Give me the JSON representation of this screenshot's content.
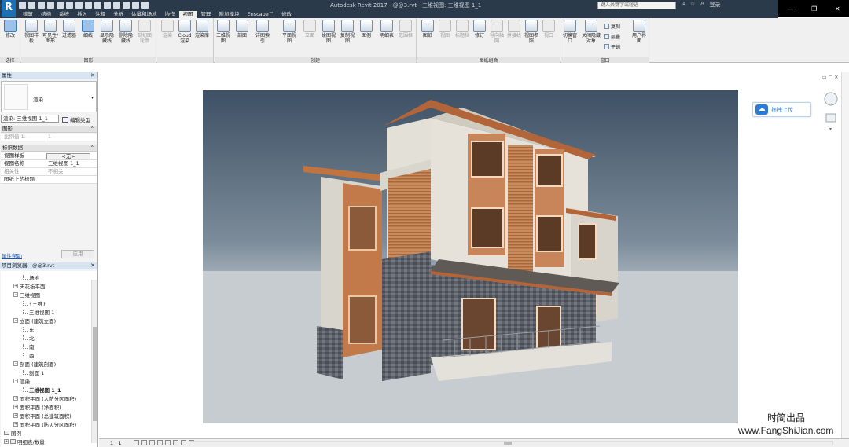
{
  "app": {
    "title": "Autodesk Revit 2017  -  @@3.rvt - 三维视图: 三维视图 1_1",
    "logo_letter": "R",
    "search_placeholder": "键入关键字或短语",
    "login": "登录",
    "window_controls": [
      "—",
      "❐",
      "✕"
    ]
  },
  "tabs": [
    "建筑",
    "结构",
    "系统",
    "插入",
    "注释",
    "分析",
    "体量和场地",
    "协作",
    "视图",
    "管理",
    "附加模块",
    "Enscape™",
    "修改"
  ],
  "active_tab": "视图",
  "ribbon": {
    "select": {
      "label": "选择",
      "modify": "修改"
    },
    "graphics": {
      "label": "图形",
      "buttons": [
        "视图样板",
        "可见性/图形",
        "过滤器",
        "细线",
        "显示隐藏线",
        "删除隐藏线",
        "剖切面轮廓"
      ]
    },
    "presentation": {
      "buttons": [
        "渲染",
        "Cloud渲染",
        "渲染库"
      ]
    },
    "create": {
      "label": "创建",
      "buttons": [
        "三维视图",
        "剖面",
        "详图索引",
        "平面视图",
        "立面",
        "绘图视图",
        "复制视图",
        "图例",
        "明细表",
        "范围框"
      ]
    },
    "sheet": {
      "label": "图纸组合",
      "buttons": [
        "图纸",
        "视图",
        "标题栏",
        "修订",
        "导向轴网",
        "拼接线",
        "视图参照",
        "视口"
      ]
    },
    "windows": {
      "label": "窗口",
      "buttons": [
        "切换窗口",
        "关闭隐藏对象",
        "复制",
        "层叠",
        "平铺",
        "用户界面"
      ]
    }
  },
  "properties": {
    "header": "属性",
    "type_name": "渲染",
    "type_selector": "渲染: 三维视图 1_1",
    "edit_type": "编辑类型",
    "sections": [
      {
        "name": "图形",
        "rows": [
          {
            "k": "比例值 1:",
            "v": "1",
            "grey": true
          }
        ]
      },
      {
        "name": "标识数据",
        "rows": [
          {
            "k": "视图样板",
            "v": "<无>",
            "button": true
          },
          {
            "k": "视图名称",
            "v": "三维视图 1_1"
          },
          {
            "k": "相关性",
            "v": "不相关",
            "grey": true
          },
          {
            "k": "图纸上的标题",
            "v": ""
          }
        ]
      }
    ],
    "help_link": "属性帮助",
    "apply": "应用"
  },
  "browser": {
    "header": "项目浏览器 - @@3.rvt",
    "items": [
      {
        "label": "场地",
        "level": 2,
        "toggle": ""
      },
      {
        "label": "天花板平面",
        "level": 1,
        "toggle": "+"
      },
      {
        "label": "三维视图",
        "level": 1,
        "toggle": "-"
      },
      {
        "label": "{三维}",
        "level": 2,
        "toggle": ""
      },
      {
        "label": "三维视图 1",
        "level": 2,
        "toggle": ""
      },
      {
        "label": "立面 (建筑立面)",
        "level": 1,
        "toggle": "-"
      },
      {
        "label": "东",
        "level": 2,
        "toggle": ""
      },
      {
        "label": "北",
        "level": 2,
        "toggle": ""
      },
      {
        "label": "南",
        "level": 2,
        "toggle": ""
      },
      {
        "label": "西",
        "level": 2,
        "toggle": ""
      },
      {
        "label": "剖面 (建筑剖面)",
        "level": 1,
        "toggle": "-"
      },
      {
        "label": "剖面 1",
        "level": 2,
        "toggle": ""
      },
      {
        "label": "渲染",
        "level": 1,
        "toggle": "-"
      },
      {
        "label": "三维视图 1_1",
        "level": 2,
        "toggle": "",
        "bold": true
      },
      {
        "label": "面积平面 (人防分区面积)",
        "level": 1,
        "toggle": "+"
      },
      {
        "label": "面积平面 (净面积)",
        "level": 1,
        "toggle": "+"
      },
      {
        "label": "面积平面 (总建筑面积)",
        "level": 1,
        "toggle": "+"
      },
      {
        "label": "面积平面 (防火分区面积)",
        "level": 1,
        "toggle": "+"
      },
      {
        "label": "图例",
        "level": 0,
        "toggle": "",
        "icon": true
      },
      {
        "label": "明细表/数量",
        "level": 0,
        "toggle": "+",
        "icon": true
      }
    ]
  },
  "canvas": {
    "upload_button": "拖拽上传",
    "watermark_cn": "时简出品",
    "watermark_url": "www.FangShiJian.com"
  },
  "status": {
    "scale": "1 : 1"
  }
}
